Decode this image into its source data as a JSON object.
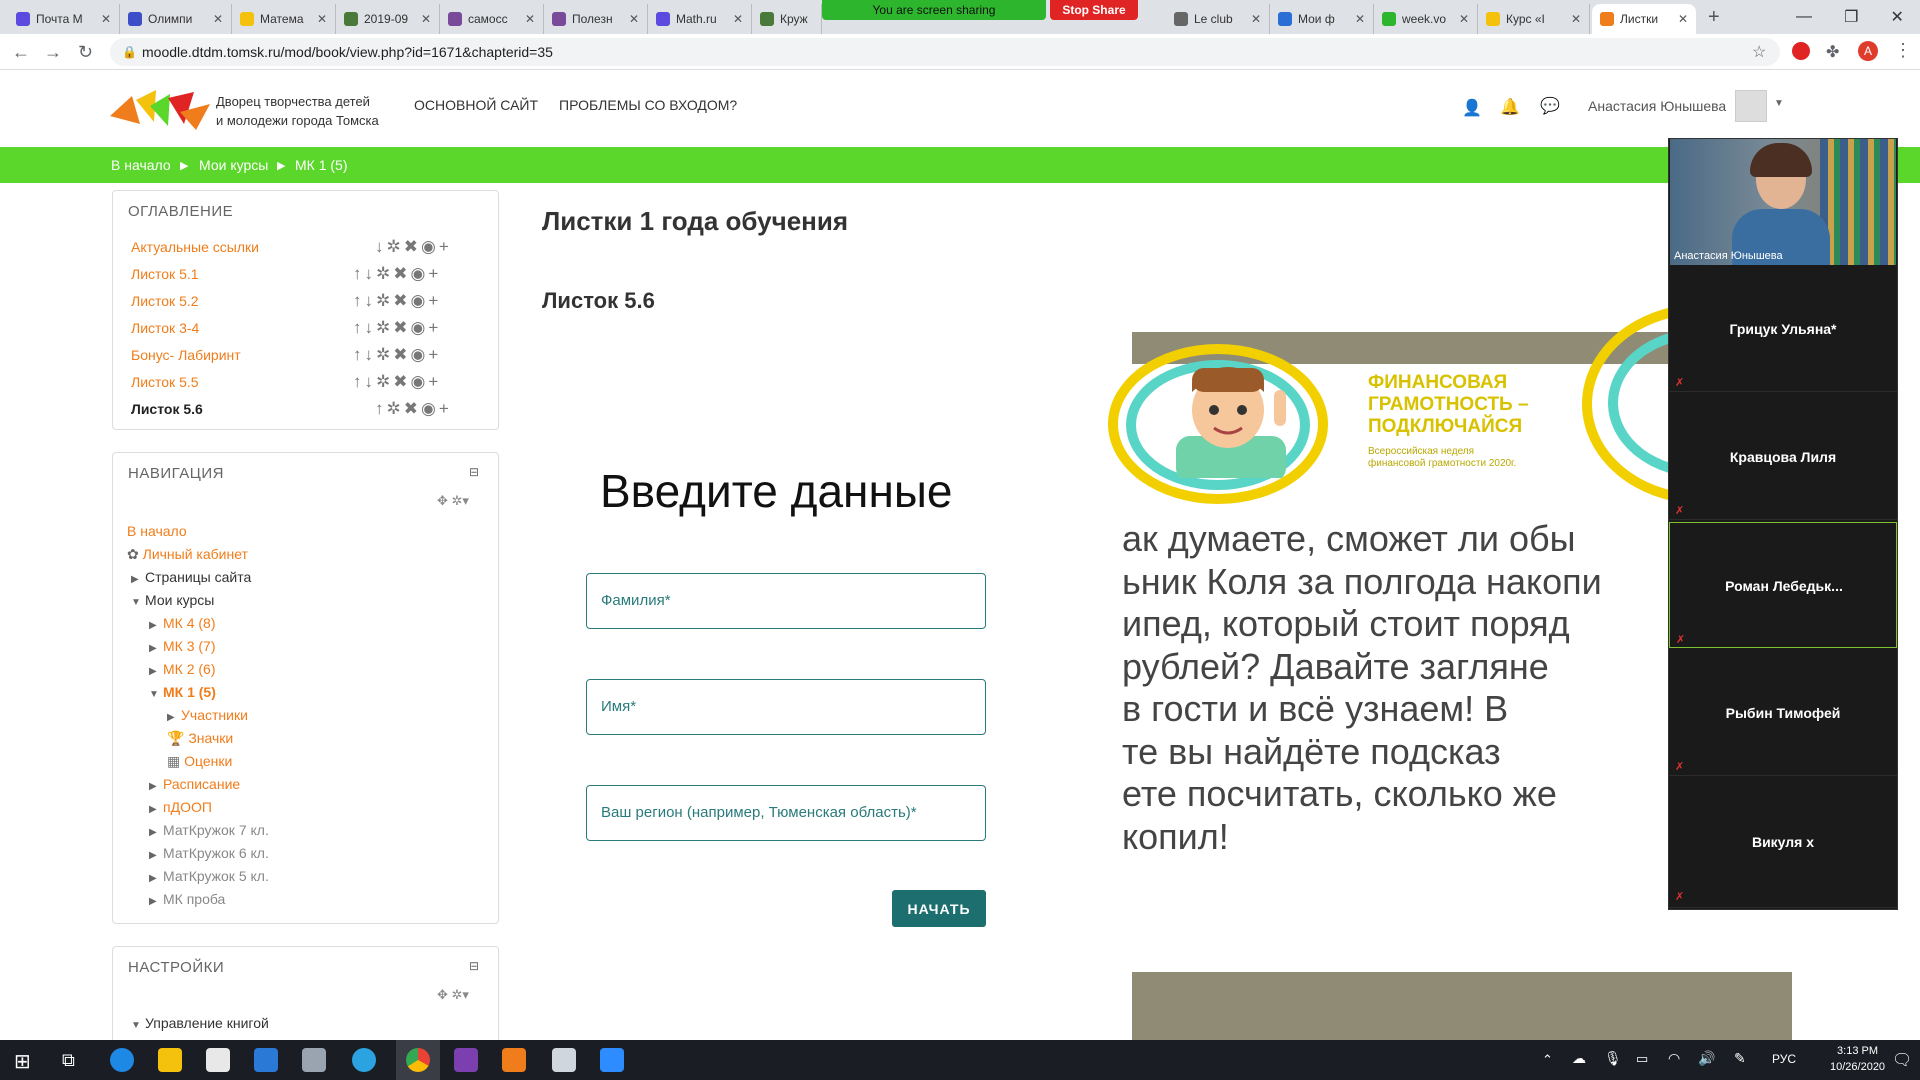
{
  "browser": {
    "tabs": [
      {
        "label": "Почта M",
        "color": "#5b4ae0"
      },
      {
        "label": "Олимпи",
        "color": "#3c4ec8"
      },
      {
        "label": "Матема",
        "color": "#f4c20d"
      },
      {
        "label": "2019-09",
        "color": "#4a7a3a"
      },
      {
        "label": "самосс",
        "color": "#7a4a9a"
      },
      {
        "label": "Полезн",
        "color": "#7a4a9a"
      },
      {
        "label": "Math.ru",
        "color": "#5b4ae0"
      },
      {
        "label": "Круж",
        "color": "#4a7a3a"
      },
      {
        "label": "Le club",
        "color": "#666666"
      },
      {
        "label": "Мои ф",
        "color": "#2b6fd6"
      },
      {
        "label": "week.vo",
        "color": "#2db52d"
      },
      {
        "label": "Курс «I",
        "color": "#f4c20d"
      },
      {
        "label": "Листки",
        "color": "#f07d1b"
      }
    ],
    "sharing_text": "You are screen sharing",
    "stop_share": "Stop Share",
    "url": "moodle.dtdm.tomsk.ru/mod/book/view.php?id=1671&chapterid=35"
  },
  "header": {
    "org_line1": "Дворец творчества детей",
    "org_line2": "и молодежи города Томска",
    "nav_main": "ОСНОВНОЙ САЙТ",
    "nav_login": "ПРОБЛЕМЫ СО ВХОДОМ?",
    "username": "Анастасия Юнышева"
  },
  "breadcrumb": {
    "home": "В начало",
    "courses": "Мои курсы",
    "course": "МК 1 (5)"
  },
  "toc": {
    "title": "ОГЛАВЛЕНИЕ",
    "items": [
      {
        "label": "Актуальные ссылки"
      },
      {
        "label": "Листок 5.1"
      },
      {
        "label": "Листок 5.2"
      },
      {
        "label": "Листок 3-4"
      },
      {
        "label": "Бонус- Лабиринт"
      },
      {
        "label": "Листок 5.5"
      },
      {
        "label": "Листок 5.6"
      }
    ]
  },
  "navigation": {
    "title": "НАВИГАЦИЯ",
    "home": "В начало",
    "dashboard": "Личный кабинет",
    "site_pages": "Страницы сайта",
    "my_courses": "Мои курсы",
    "courses": [
      "МК 4 (8)",
      "МК 3 (7)",
      "МК 2 (6)"
    ],
    "current_course": "МК 1 (5)",
    "participants": "Участники",
    "badges": "Значки",
    "grades": "Оценки",
    "schedule": "Расписание",
    "pdoop": "пДООП",
    "muted_courses": [
      "МатКружок 7 кл.",
      "МатКружок 6 кл.",
      "МатКружок 5 кл.",
      "МК проба"
    ]
  },
  "settings": {
    "title": "НАСТРОЙКИ",
    "manage_book": "Управление книгой"
  },
  "content": {
    "chapter_title": "Листки 1 года обучения",
    "sub_title": "Листок 5.6",
    "form_heading": "Введите данные",
    "field_surname": "Фамилия*",
    "field_name": "Имя*",
    "field_region": "Ваш регион (например, Тюменская область)*",
    "start_button": "НАЧАТЬ",
    "banner_title_1": "ФИНАНСОВАЯ",
    "banner_title_2": "ГРАМОТНОСТЬ –",
    "banner_title_3": "ПОДКЛЮЧАЙСЯ",
    "banner_sub_1": "Всероссийская неделя",
    "banner_sub_2": "финансовой грамотности 2020г.",
    "story_lines": [
      "ак думаете, сможет ли обы",
      "ьник Коля за полгода накопи",
      "ипед, который стоит поряд",
      " рублей? Давайте загляне",
      " в гости и всё узнаем! В",
      "те вы найдёте подсказ",
      "ете посчитать, сколько же",
      "копил!"
    ]
  },
  "video": {
    "self_name": "Анастасия Юнышева",
    "participants": [
      "Грицук Ульяна*",
      "Кравцова Лиля",
      "Роман  Лебедьк...",
      "Рыбин Тимофей",
      "Викуля  x"
    ]
  },
  "taskbar": {
    "lang": "РУС",
    "time": "3:13 PM",
    "date": "10/26/2020"
  },
  "colors": {
    "accent_green": "#5bd62a",
    "link_orange": "#f07d1b",
    "teal": "#1d6e6e"
  }
}
